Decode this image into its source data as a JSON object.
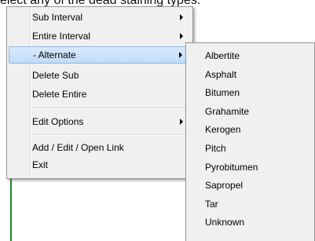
{
  "background_text": "elect any of the dead staining types:",
  "main_menu": {
    "items": [
      {
        "label": "Sub Interval"
      },
      {
        "label": "Entire Interval"
      },
      {
        "label": "- Alternate"
      },
      {
        "label": "Delete Sub"
      },
      {
        "label": "Delete Entire"
      },
      {
        "label": "Edit Options"
      },
      {
        "label": "Add / Edit / Open Link"
      },
      {
        "label": "Exit"
      }
    ]
  },
  "submenu": {
    "items": [
      {
        "label": "Albertite"
      },
      {
        "label": "Asphalt"
      },
      {
        "label": "Bitumen"
      },
      {
        "label": "Grahamite"
      },
      {
        "label": "Kerogen"
      },
      {
        "label": "Pitch"
      },
      {
        "label": "Pyrobitumen"
      },
      {
        "label": "Sapropel"
      },
      {
        "label": "Tar"
      },
      {
        "label": "Unknown"
      }
    ]
  },
  "colors": {
    "menu_bg": "#f0f0f0",
    "highlight": "#c2dcf7",
    "highlight_border": "#8fb8e6",
    "green_line": "#1f8a2a"
  }
}
